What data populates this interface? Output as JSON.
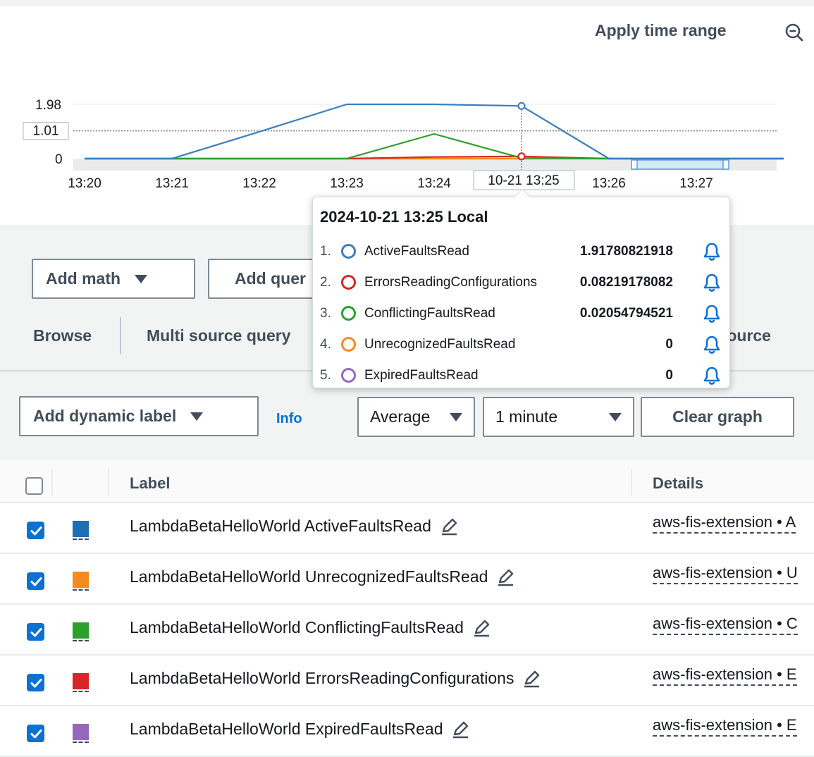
{
  "header": {
    "apply_time_range": "Apply time range",
    "zoom_icon": "zoom-out-icon"
  },
  "chart_data": {
    "type": "line",
    "y_ticks": [
      "1.98",
      "0"
    ],
    "y_crosshair_label": "1.01",
    "x_ticks": [
      "13:20",
      "13:21",
      "13:22",
      "13:23",
      "13:24",
      "13:26",
      "13:27"
    ],
    "x_crosshair_label": "10-21 13:25",
    "x": [
      "13:20",
      "13:21",
      "13:22",
      "13:23",
      "13:24",
      "13:25",
      "13:26",
      "13:27",
      "13:28"
    ],
    "ylim": [
      0,
      1.98
    ],
    "series": [
      {
        "name": "ActiveFaultsRead",
        "color": "#3b7fc1",
        "values": [
          0,
          0,
          0.98,
          1.98,
          1.98,
          1.92,
          0,
          0,
          0
        ]
      },
      {
        "name": "UnrecognizedFaultsRead",
        "color": "#f58b1f",
        "values": [
          0,
          0,
          0,
          0,
          0,
          0,
          0,
          0,
          0
        ]
      },
      {
        "name": "ConflictingFaultsRead",
        "color": "#2ca02c",
        "values": [
          0,
          0,
          0,
          0,
          0.9,
          0.02,
          0,
          0,
          0
        ]
      },
      {
        "name": "ErrorsReadingConfigurations",
        "color": "#d62728",
        "values": [
          0,
          0,
          0,
          0,
          0.06,
          0.08,
          0,
          0,
          0
        ]
      },
      {
        "name": "ExpiredFaultsRead",
        "color": "#9467bd",
        "values": [
          0,
          0,
          0,
          0,
          0,
          0,
          0,
          0,
          0
        ]
      }
    ]
  },
  "tooltip": {
    "title": "2024-10-21 13:25 Local",
    "rows": [
      {
        "num": "1.",
        "name": "ActiveFaultsRead",
        "value": "1.91780821918",
        "color": "#3b7fc1"
      },
      {
        "num": "2.",
        "name": "ErrorsReadingConfigurations",
        "value": "0.08219178082",
        "color": "#d62728"
      },
      {
        "num": "3.",
        "name": "ConflictingFaultsRead",
        "value": "0.02054794521",
        "color": "#2ca02c"
      },
      {
        "num": "4.",
        "name": "UnrecognizedFaultsRead",
        "value": "0",
        "color": "#f58b1f"
      },
      {
        "num": "5.",
        "name": "ExpiredFaultsRead",
        "value": "0",
        "color": "#9467bd"
      }
    ]
  },
  "toolbar": {
    "add_math": "Add math",
    "add_query": "Add quer",
    "tabs": [
      "Browse",
      "Multi source query",
      "Source"
    ],
    "add_dynamic_label": "Add dynamic label",
    "info": "Info",
    "statistic": "Average",
    "period": "1 minute",
    "clear_graph": "Clear graph"
  },
  "table": {
    "headers": {
      "label": "Label",
      "details": "Details"
    },
    "rows": [
      {
        "label": "LambdaBetaHelloWorld ActiveFaultsRead",
        "details": "aws-fis-extension • A",
        "color": "#1f6fb5",
        "checked": true
      },
      {
        "label": "LambdaBetaHelloWorld UnrecognizedFaultsRead",
        "details": "aws-fis-extension • U",
        "color": "#f58b1f",
        "checked": true
      },
      {
        "label": "LambdaBetaHelloWorld ConflictingFaultsRead",
        "details": "aws-fis-extension • C",
        "color": "#2ca02c",
        "checked": true
      },
      {
        "label": "LambdaBetaHelloWorld ErrorsReadingConfigurations",
        "details": "aws-fis-extension • E",
        "color": "#d62728",
        "checked": true
      },
      {
        "label": "LambdaBetaHelloWorld ExpiredFaultsRead",
        "details": "aws-fis-extension • E",
        "color": "#9467bd",
        "checked": true
      }
    ]
  }
}
